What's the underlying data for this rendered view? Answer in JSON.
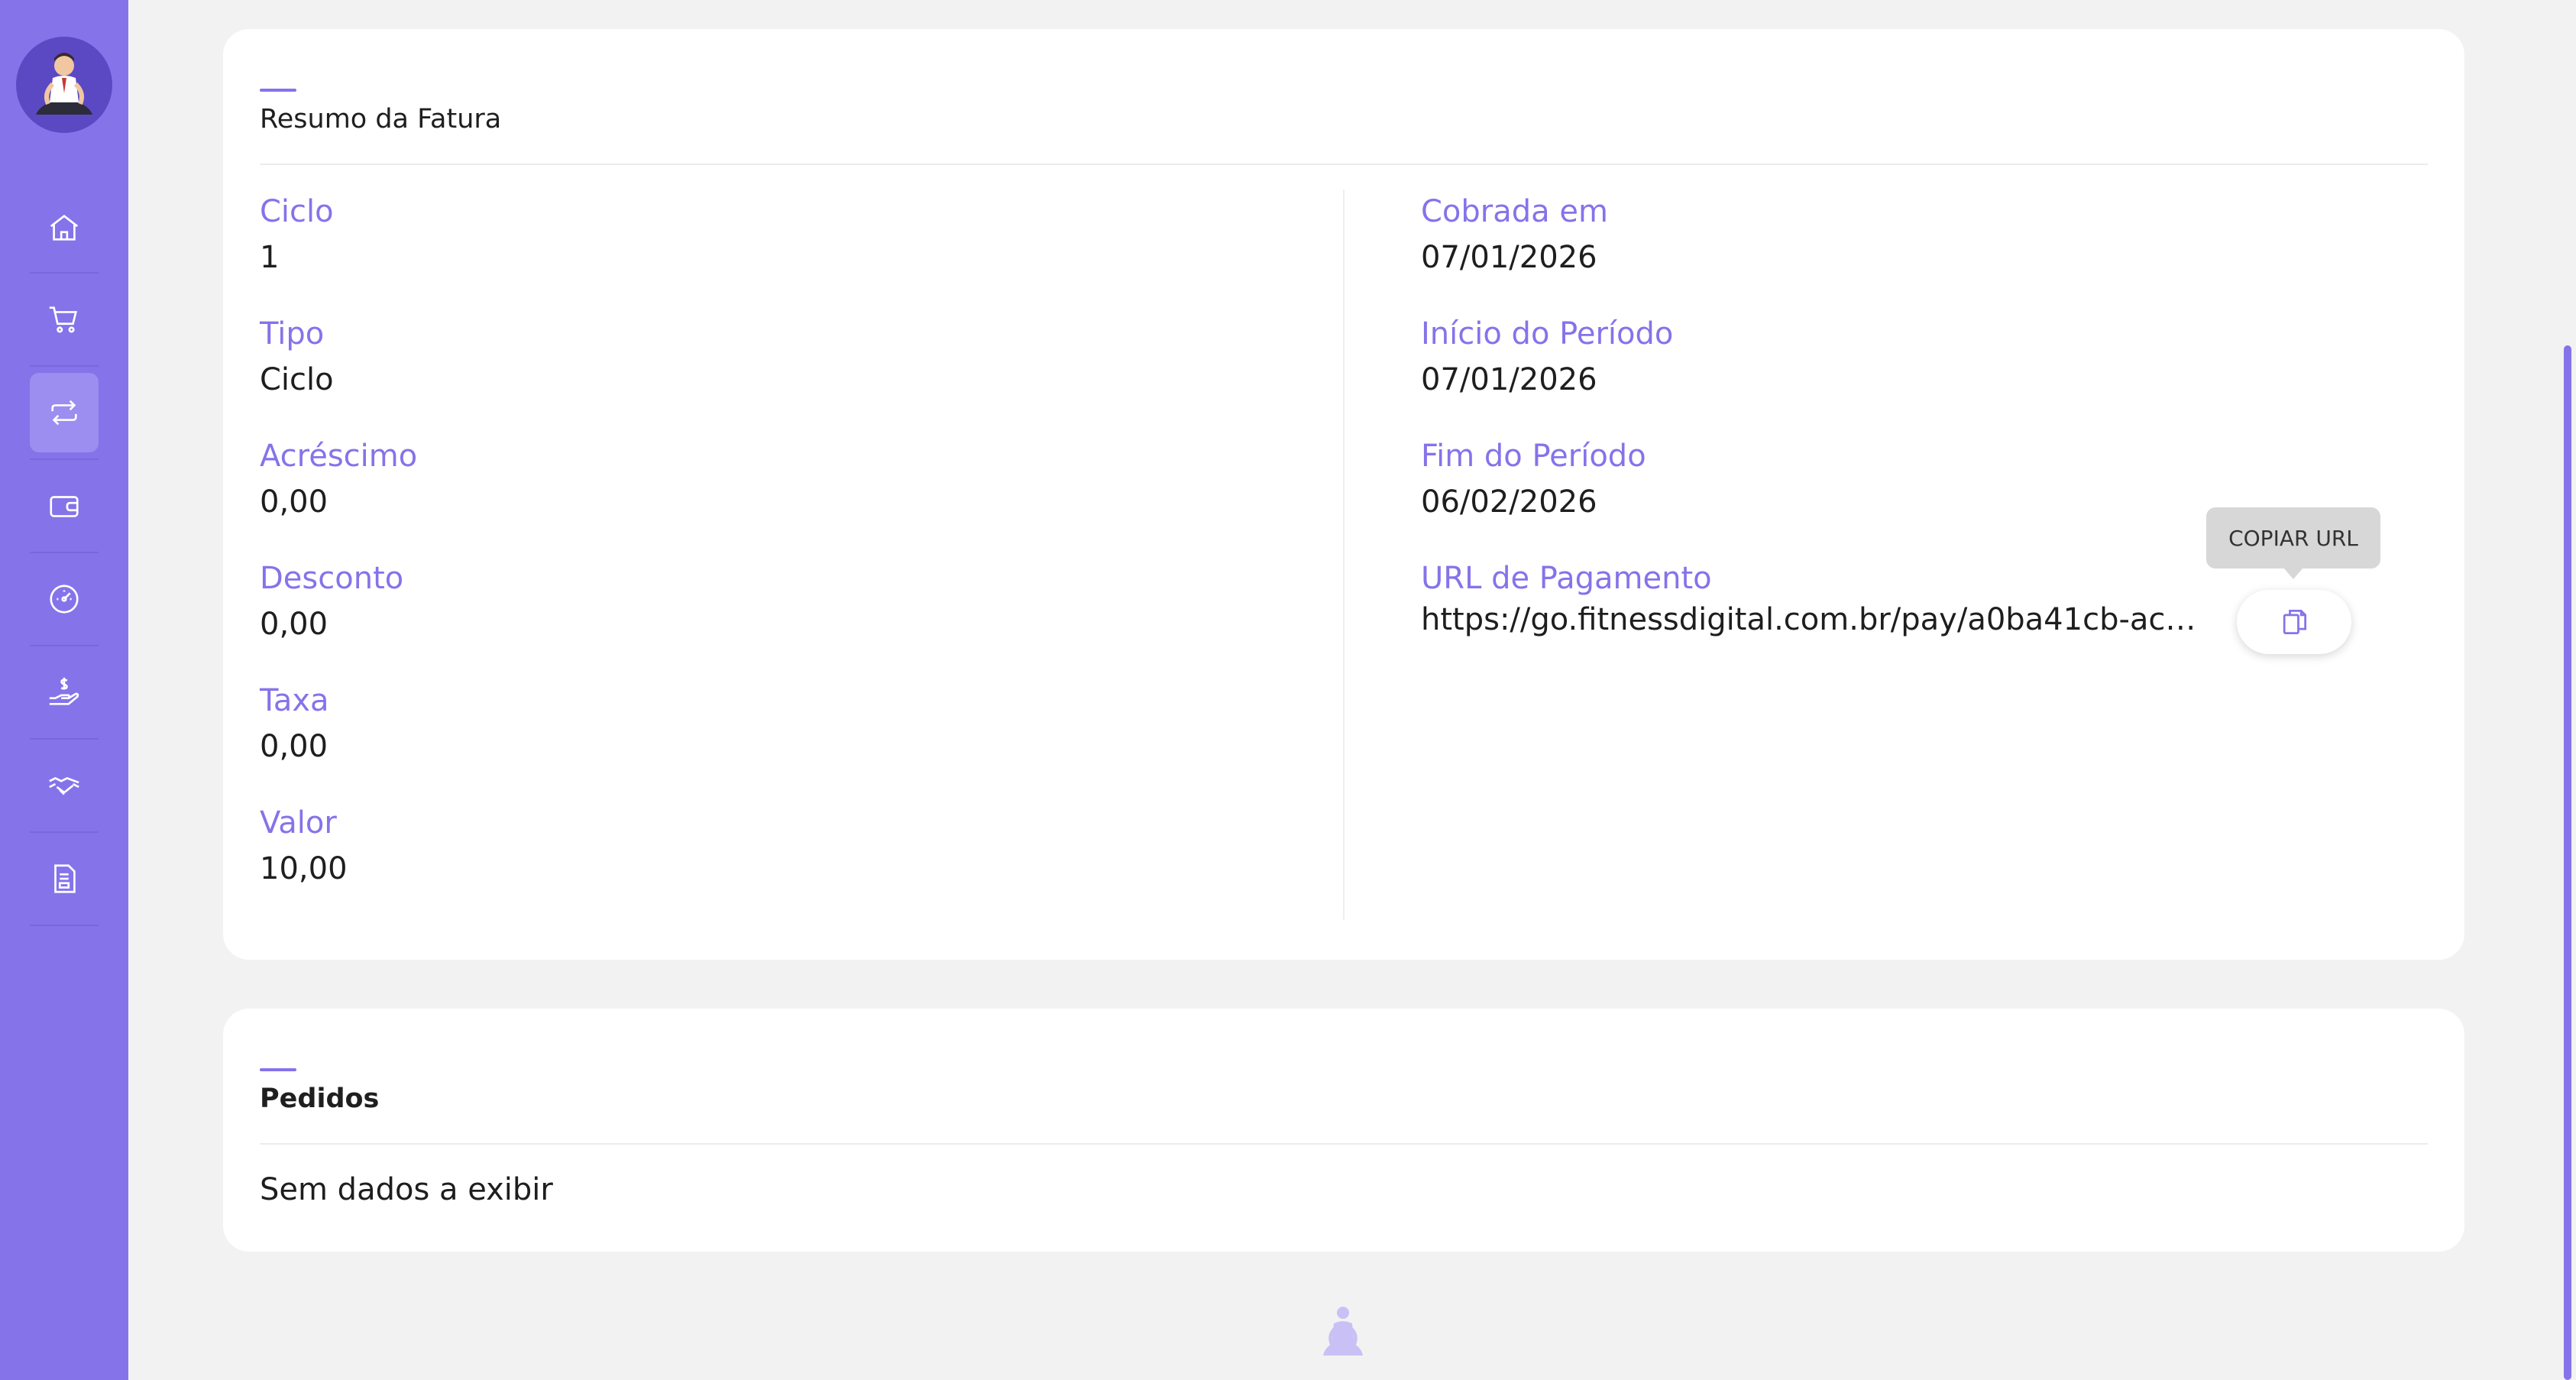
{
  "sidebar": {
    "items": [
      {
        "icon": "home-icon",
        "active": false
      },
      {
        "icon": "cart-icon",
        "active": false
      },
      {
        "icon": "recurrence-icon",
        "active": true
      },
      {
        "icon": "wallet-icon",
        "active": false
      },
      {
        "icon": "dashboard-icon",
        "active": false
      },
      {
        "icon": "hand-money-icon",
        "active": false
      },
      {
        "icon": "handshake-icon",
        "active": false
      },
      {
        "icon": "document-icon",
        "active": false
      }
    ]
  },
  "summary": {
    "title": "Resumo da Fatura",
    "left_fields": [
      {
        "label": "Ciclo",
        "value": "1"
      },
      {
        "label": "Tipo",
        "value": "Ciclo"
      },
      {
        "label": "Acréscimo",
        "value": "0,00"
      },
      {
        "label": "Desconto",
        "value": "0,00"
      },
      {
        "label": "Taxa",
        "value": "0,00"
      },
      {
        "label": "Valor",
        "value": "10,00"
      }
    ],
    "right_fields": [
      {
        "label": "Cobrada em",
        "value": "07/01/2026"
      },
      {
        "label": "Início do Período",
        "value": "07/01/2026"
      },
      {
        "label": "Fim do Período",
        "value": "06/02/2026"
      }
    ],
    "payment_url": {
      "label": "URL de Pagamento",
      "value": "https://go.fitnessdigital.com.br/pay/a0ba41cb-ace0-494...",
      "copy_tooltip": "COPIAR URL"
    }
  },
  "orders": {
    "title": "Pedidos",
    "empty_text": "Sem dados a exibir"
  },
  "colors": {
    "accent": "#8573ea",
    "sidebar_bg": "#8573ea",
    "page_bg": "#f2f2f2"
  }
}
